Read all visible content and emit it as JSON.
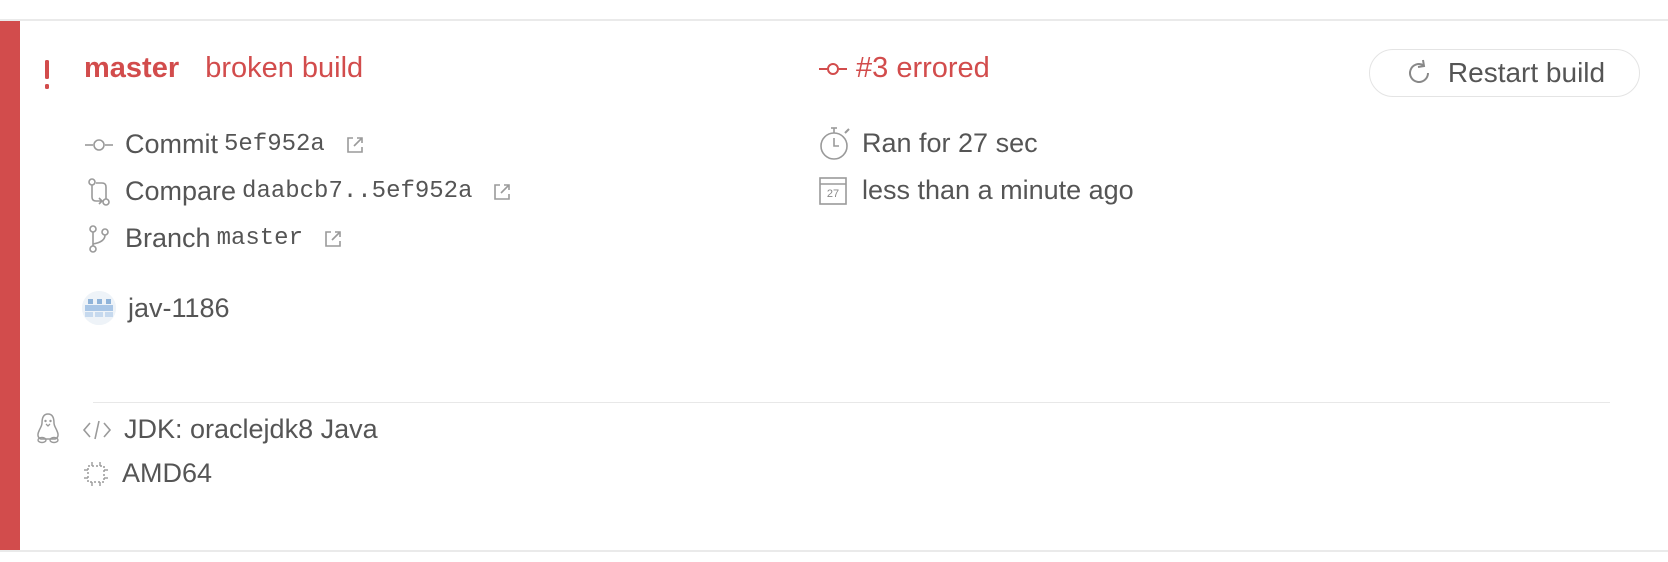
{
  "build": {
    "status_icon": "exclamation-icon",
    "branch": "master",
    "state_message": "broken build",
    "number_status": "#3 errored",
    "restart_label": "Restart build",
    "commit_label": "Commit",
    "commit_sha": "5ef952a",
    "compare_label": "Compare",
    "compare_range": "daabcb7..5ef952a",
    "branch_label": "Branch",
    "branch_value": "master",
    "author": "jav-1186",
    "duration": "Ran for 27 sec",
    "calendar_day": "27",
    "finished": "less than a minute ago"
  },
  "job_config": {
    "os_icon": "linux-penguin-icon",
    "language": "JDK: oraclejdk8 Java",
    "arch": "AMD64"
  },
  "colors": {
    "error": "#d24c4c",
    "text": "#555555",
    "muted_icon": "#9a9a9a"
  }
}
